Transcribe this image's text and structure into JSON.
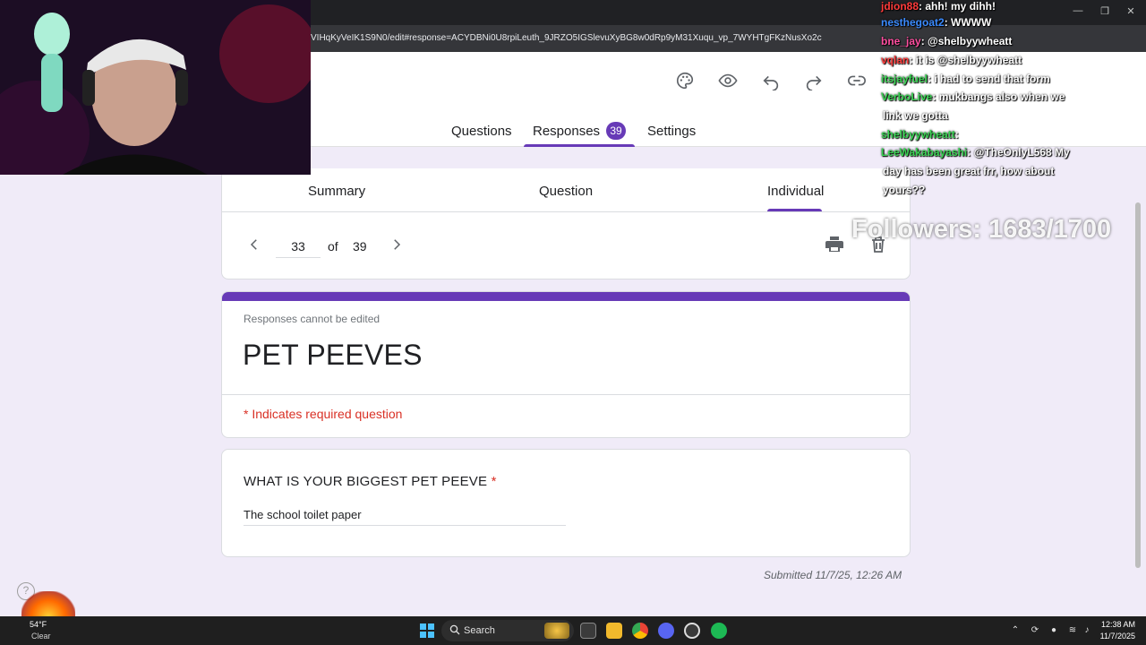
{
  "browser": {
    "url": "VIHqKyVeIK1S9N0/edit#response=ACYDBNi0U8rpiLeuth_9JRZO5IGSlevuXyBG8w0dRp9yM31Xuqu_vp_7WYHTgFKzNusXo2c"
  },
  "toolbar": {
    "icons": [
      "palette-icon",
      "eye-icon",
      "undo-icon",
      "redo-icon",
      "link-icon"
    ]
  },
  "tabs": {
    "questions": "Questions",
    "responses": "Responses",
    "responses_count": "39",
    "settings": "Settings"
  },
  "subtabs": {
    "summary": "Summary",
    "question": "Question",
    "individual": "Individual"
  },
  "pager": {
    "current": "33",
    "of_label": "of",
    "total": "39"
  },
  "form": {
    "notice": "Responses cannot be edited",
    "title": "PET PEEVES",
    "required_note": "* Indicates required question",
    "question": "WHAT IS YOUR BIGGEST PET PEEVE",
    "required_star": "*",
    "answer": "The school toilet paper",
    "submitted": "Submitted 11/7/25, 12:26 AM"
  },
  "chat": [
    {
      "user": "jdion88",
      "message": ": ahh! my dihh!",
      "color": "#ff3b3b"
    },
    {
      "user": "nesthegoat2",
      "message": ": WWWW",
      "color": "#3b8bff"
    },
    {
      "user": "bne_jay",
      "message": ": @shelbyywheatt",
      "color": "#ff4fa0"
    },
    {
      "user": "vqlan",
      "message": ": it is @shelbyywheatt",
      "color": "#ff4040"
    },
    {
      "user": "itsjayfuel",
      "message": ": i had to send that form",
      "color": "#39d353"
    },
    {
      "user": "VerboLive",
      "message": ": mukbangs also when we",
      "color": "#39d353"
    },
    {
      "user": "",
      "message": "link we gotta",
      "color": "#ffffff"
    },
    {
      "user": "shelbyywheatt",
      "message": ":",
      "color": "#39d353"
    },
    {
      "user": "LeeWakabayashi",
      "message": ": @TheOnlyL568 My",
      "color": "#39d353"
    },
    {
      "user": "",
      "message": "day has been great frr, how about",
      "color": "#ffffff"
    },
    {
      "user": "",
      "message": "yours??",
      "color": "#ffffff"
    }
  ],
  "followers": "Followers: 1683/1700",
  "taskbar": {
    "weather_temp": "54°F",
    "weather_cond": "Clear",
    "search": "Search",
    "time": "12:38 AM",
    "date": "11/7/2025"
  },
  "colors": {
    "accent": "#673ab7",
    "required": "#d93025",
    "page_bg": "#f0ebf8"
  }
}
